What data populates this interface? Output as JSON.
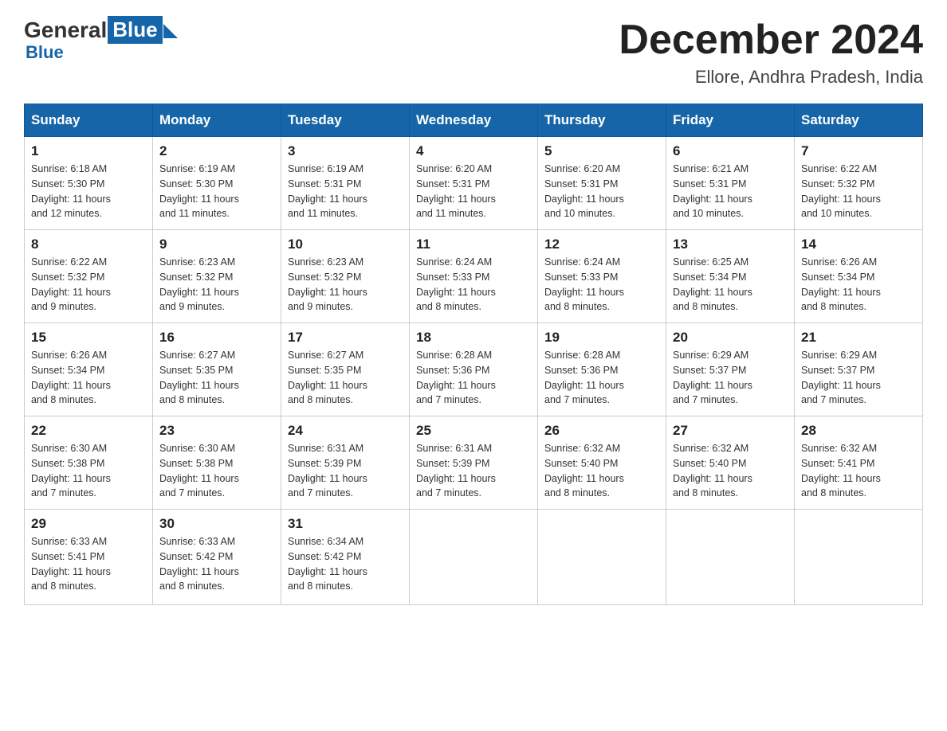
{
  "header": {
    "logo_general": "General",
    "logo_blue": "Blue",
    "month_title": "December 2024",
    "location": "Ellore, Andhra Pradesh, India"
  },
  "days_of_week": [
    "Sunday",
    "Monday",
    "Tuesday",
    "Wednesday",
    "Thursday",
    "Friday",
    "Saturday"
  ],
  "weeks": [
    [
      {
        "day": "1",
        "sunrise": "6:18 AM",
        "sunset": "5:30 PM",
        "daylight": "11 hours and 12 minutes."
      },
      {
        "day": "2",
        "sunrise": "6:19 AM",
        "sunset": "5:30 PM",
        "daylight": "11 hours and 11 minutes."
      },
      {
        "day": "3",
        "sunrise": "6:19 AM",
        "sunset": "5:31 PM",
        "daylight": "11 hours and 11 minutes."
      },
      {
        "day": "4",
        "sunrise": "6:20 AM",
        "sunset": "5:31 PM",
        "daylight": "11 hours and 11 minutes."
      },
      {
        "day": "5",
        "sunrise": "6:20 AM",
        "sunset": "5:31 PM",
        "daylight": "11 hours and 10 minutes."
      },
      {
        "day": "6",
        "sunrise": "6:21 AM",
        "sunset": "5:31 PM",
        "daylight": "11 hours and 10 minutes."
      },
      {
        "day": "7",
        "sunrise": "6:22 AM",
        "sunset": "5:32 PM",
        "daylight": "11 hours and 10 minutes."
      }
    ],
    [
      {
        "day": "8",
        "sunrise": "6:22 AM",
        "sunset": "5:32 PM",
        "daylight": "11 hours and 9 minutes."
      },
      {
        "day": "9",
        "sunrise": "6:23 AM",
        "sunset": "5:32 PM",
        "daylight": "11 hours and 9 minutes."
      },
      {
        "day": "10",
        "sunrise": "6:23 AM",
        "sunset": "5:32 PM",
        "daylight": "11 hours and 9 minutes."
      },
      {
        "day": "11",
        "sunrise": "6:24 AM",
        "sunset": "5:33 PM",
        "daylight": "11 hours and 8 minutes."
      },
      {
        "day": "12",
        "sunrise": "6:24 AM",
        "sunset": "5:33 PM",
        "daylight": "11 hours and 8 minutes."
      },
      {
        "day": "13",
        "sunrise": "6:25 AM",
        "sunset": "5:34 PM",
        "daylight": "11 hours and 8 minutes."
      },
      {
        "day": "14",
        "sunrise": "6:26 AM",
        "sunset": "5:34 PM",
        "daylight": "11 hours and 8 minutes."
      }
    ],
    [
      {
        "day": "15",
        "sunrise": "6:26 AM",
        "sunset": "5:34 PM",
        "daylight": "11 hours and 8 minutes."
      },
      {
        "day": "16",
        "sunrise": "6:27 AM",
        "sunset": "5:35 PM",
        "daylight": "11 hours and 8 minutes."
      },
      {
        "day": "17",
        "sunrise": "6:27 AM",
        "sunset": "5:35 PM",
        "daylight": "11 hours and 8 minutes."
      },
      {
        "day": "18",
        "sunrise": "6:28 AM",
        "sunset": "5:36 PM",
        "daylight": "11 hours and 7 minutes."
      },
      {
        "day": "19",
        "sunrise": "6:28 AM",
        "sunset": "5:36 PM",
        "daylight": "11 hours and 7 minutes."
      },
      {
        "day": "20",
        "sunrise": "6:29 AM",
        "sunset": "5:37 PM",
        "daylight": "11 hours and 7 minutes."
      },
      {
        "day": "21",
        "sunrise": "6:29 AM",
        "sunset": "5:37 PM",
        "daylight": "11 hours and 7 minutes."
      }
    ],
    [
      {
        "day": "22",
        "sunrise": "6:30 AM",
        "sunset": "5:38 PM",
        "daylight": "11 hours and 7 minutes."
      },
      {
        "day": "23",
        "sunrise": "6:30 AM",
        "sunset": "5:38 PM",
        "daylight": "11 hours and 7 minutes."
      },
      {
        "day": "24",
        "sunrise": "6:31 AM",
        "sunset": "5:39 PM",
        "daylight": "11 hours and 7 minutes."
      },
      {
        "day": "25",
        "sunrise": "6:31 AM",
        "sunset": "5:39 PM",
        "daylight": "11 hours and 7 minutes."
      },
      {
        "day": "26",
        "sunrise": "6:32 AM",
        "sunset": "5:40 PM",
        "daylight": "11 hours and 8 minutes."
      },
      {
        "day": "27",
        "sunrise": "6:32 AM",
        "sunset": "5:40 PM",
        "daylight": "11 hours and 8 minutes."
      },
      {
        "day": "28",
        "sunrise": "6:32 AM",
        "sunset": "5:41 PM",
        "daylight": "11 hours and 8 minutes."
      }
    ],
    [
      {
        "day": "29",
        "sunrise": "6:33 AM",
        "sunset": "5:41 PM",
        "daylight": "11 hours and 8 minutes."
      },
      {
        "day": "30",
        "sunrise": "6:33 AM",
        "sunset": "5:42 PM",
        "daylight": "11 hours and 8 minutes."
      },
      {
        "day": "31",
        "sunrise": "6:34 AM",
        "sunset": "5:42 PM",
        "daylight": "11 hours and 8 minutes."
      },
      null,
      null,
      null,
      null
    ]
  ],
  "labels": {
    "sunrise": "Sunrise:",
    "sunset": "Sunset:",
    "daylight": "Daylight:"
  }
}
